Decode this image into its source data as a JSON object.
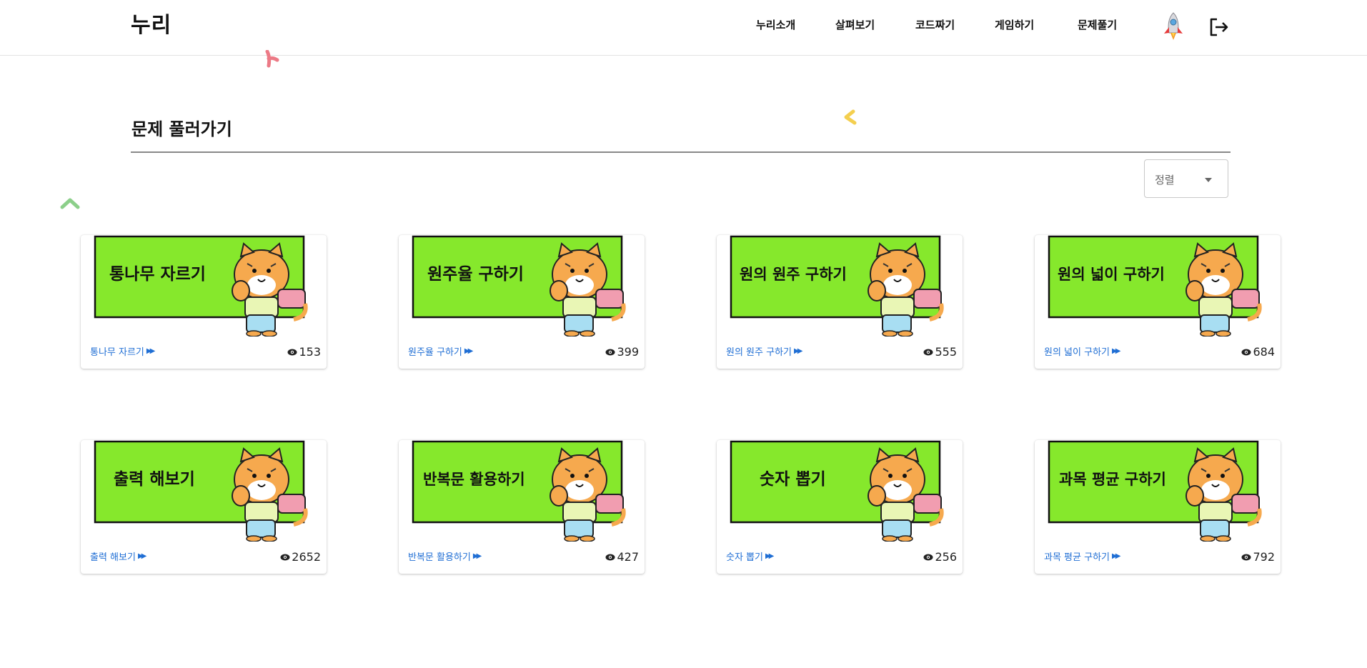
{
  "header": {
    "logo": "누리",
    "nav": [
      "누리소개",
      "살펴보기",
      "코드짜기",
      "게임하기",
      "문제풀기"
    ]
  },
  "main": {
    "title": "문제 풀러가기",
    "sort": {
      "label": "정렬"
    }
  },
  "cards": [
    {
      "thumb_text": "통나무 자르기",
      "link": "통나무 자르기",
      "views": "153"
    },
    {
      "thumb_text": "원주율 구하기",
      "link": "원주율 구하기",
      "views": "399"
    },
    {
      "thumb_text": "원의 원주 구하기",
      "link": "원의 원주 구하기",
      "views": "555"
    },
    {
      "thumb_text": "원의 넓이 구하기",
      "link": "원의 넓이 구하기",
      "views": "684"
    },
    {
      "thumb_text": "출력 해보기",
      "link": "출력 해보기",
      "views": "2652"
    },
    {
      "thumb_text": "반복문 활용하기",
      "link": "반복문 활용하기",
      "views": "427"
    },
    {
      "thumb_text": "숫자 뽑기",
      "link": "숫자 뽑기",
      "views": "256"
    },
    {
      "thumb_text": "과목 평균 구하기",
      "link": "과목 평균 구하기",
      "views": "792"
    }
  ],
  "icons": {
    "avatar": "rocket-icon",
    "logout": "logout-icon",
    "views": "eye-icon",
    "link_arrow": "double-chevron-right-icon"
  },
  "colors": {
    "link": "#1f6ed4",
    "thumb_bg": "#86e82c",
    "tiger": "#f6a94e"
  }
}
